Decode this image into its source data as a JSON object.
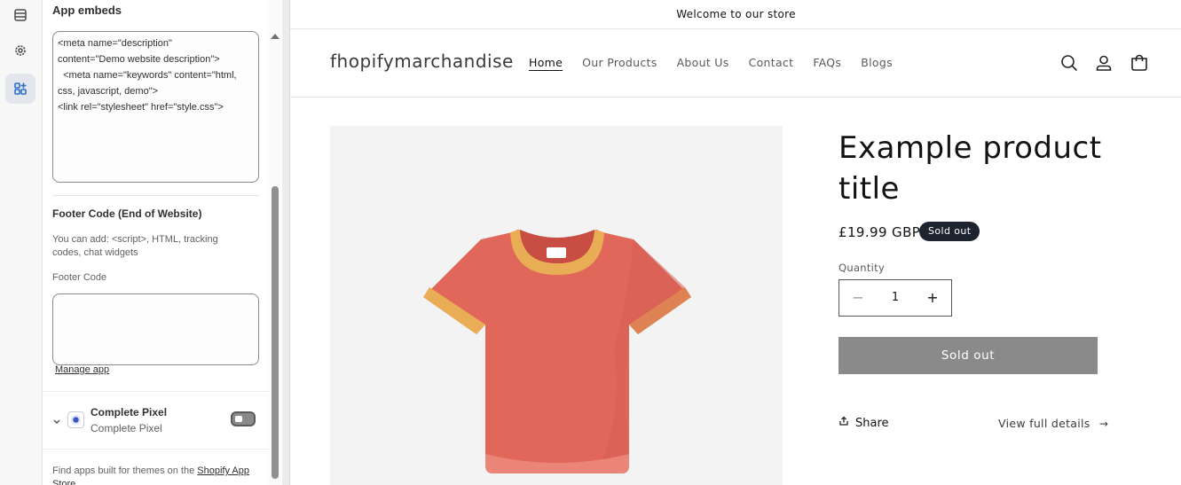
{
  "sidebar": {
    "title": "App embeds",
    "header_code_value": "<meta name=\"description\"\ncontent=\"Demo website description\">\n  <meta name=\"keywords\" content=\"html,\ncss, javascript, demo\">\n<link rel=\"stylesheet\" href=\"style.css\">",
    "footer_section_title": "Footer Code (End of Website)",
    "footer_help": "You can add: <script>, HTML, tracking codes, chat widgets",
    "footer_field_label": "Footer Code",
    "footer_code_value": "",
    "manage_app_link": "Manage app",
    "pixel_app": {
      "name": "Complete Pixel",
      "subtitle": "Complete Pixel",
      "enabled": false
    },
    "footer_note_prefix": "Find apps built for themes on the ",
    "footer_note_link": "Shopify App Store"
  },
  "store": {
    "announcement": "Welcome to our store",
    "brand": "fhopifymarchandise",
    "nav": [
      "Home",
      "Our Products",
      "About Us",
      "Contact",
      "FAQs",
      "Blogs"
    ],
    "active_nav": "Home",
    "header_icons": [
      "search-icon",
      "account-icon",
      "cart-icon"
    ]
  },
  "product": {
    "title": "Example product title",
    "price": "£19.99 GBP",
    "badge": "Sold out",
    "quantity_label": "Quantity",
    "quantity": "1",
    "button_label": "Sold out",
    "share_label": "Share",
    "details_label": "View full details",
    "image": "red-tshirt"
  },
  "colors": {
    "tshirt": "#e0675a",
    "collar": "#e9ae55",
    "button_disabled": "#8a8a8a",
    "badge": "#1e2330"
  }
}
